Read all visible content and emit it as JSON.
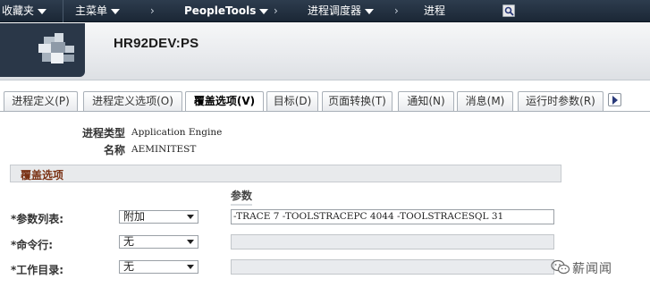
{
  "nav": {
    "favorites": "收藏夹",
    "main_menu": "主菜单",
    "peopletools": "PeopleTools",
    "process_scheduler": "进程调度器",
    "processes": "进程",
    "chevron": "›"
  },
  "header": {
    "server": "HR92DEV:PS"
  },
  "tabs": [
    {
      "label": "进程定义(P)"
    },
    {
      "label": "进程定义选项(O)"
    },
    {
      "label": "覆盖选项(V)"
    },
    {
      "label": "目标(D)"
    },
    {
      "label": "页面转换(T)"
    },
    {
      "label": "通知(N)"
    },
    {
      "label": "消息(M)"
    },
    {
      "label": "运行时参数(R)"
    }
  ],
  "active_tab": "覆盖选项(V)",
  "process": {
    "type_label": "进程类型",
    "type_value": "Application Engine",
    "name_label": "名称",
    "name_value": "AEMINITEST"
  },
  "section": {
    "title": "覆盖选项"
  },
  "params": {
    "column_header": "参数",
    "rows": [
      {
        "label": "*参数列表:",
        "select": "附加",
        "value": "-TRACE 7 -TOOLSTRACEPC 4044  -TOOLSTRACESQL 31"
      },
      {
        "label": "*命令行:",
        "select": "无",
        "value": ""
      },
      {
        "label": "*工作目录:",
        "select": "无",
        "value": ""
      }
    ]
  },
  "watermark": {
    "text": "薪闻闻"
  },
  "colors": {
    "nav_bg": "#1f2b3a",
    "section_title": "#7a3214",
    "accent_link": "#2a3a7a"
  }
}
